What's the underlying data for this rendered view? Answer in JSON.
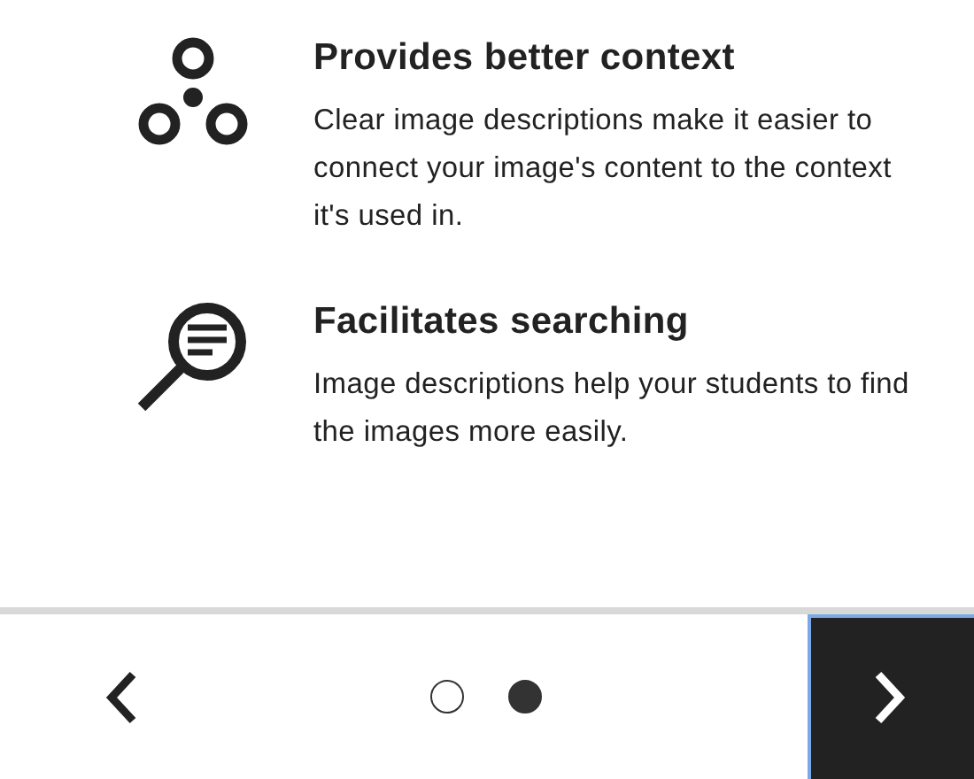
{
  "features": [
    {
      "kind": "network",
      "title": "Provides better context",
      "text": "Clear image descriptions make it easier to connect your image's content to the context it's used in."
    },
    {
      "kind": "search",
      "title": "Facilitates searching",
      "text": "Image descriptions help your students to find the images more easily."
    }
  ],
  "pager": {
    "pages": [
      {
        "selected": false
      },
      {
        "selected": true
      }
    ]
  }
}
